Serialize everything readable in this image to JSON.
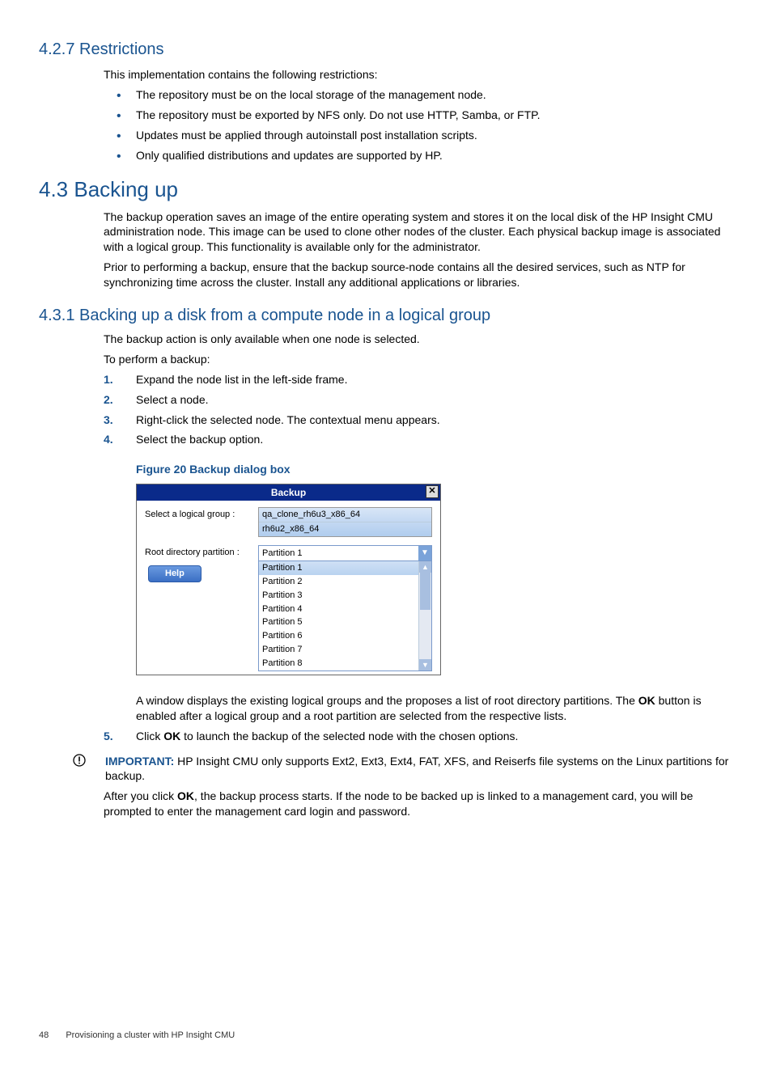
{
  "h427": "4.2.7 Restrictions",
  "p427": "This implementation contains the following restrictions:",
  "bullets427": [
    "The repository must be on the local storage of the management node.",
    "The repository must be exported by NFS only. Do not use HTTP, Samba, or FTP.",
    "Updates must be applied through autoinstall post installation scripts.",
    "Only qualified distributions and updates are supported by HP."
  ],
  "h43": "4.3 Backing up",
  "p43a": "The backup operation saves an image of the entire operating system and stores it on the local disk of the HP Insight CMU administration node. This image can be used to clone other nodes of the cluster. Each physical backup image is associated with a logical group. This functionality is available only for the administrator.",
  "p43b": "Prior to performing a backup, ensure that the backup source-node contains all the desired services, such as NTP for synchronizing time across the cluster. Install any additional applications or libraries.",
  "h431": "4.3.1 Backing up a disk from a compute node in a logical group",
  "p431a": "The backup action is only available when one node is selected.",
  "p431b": "To perform a backup:",
  "steps": {
    "s1": "Expand the node list in the left-side frame.",
    "s2": "Select a node.",
    "s3": "Right-click the selected node. The contextual menu appears.",
    "s4": "Select the backup option.",
    "s5_pre": "Click ",
    "s5_bold": "OK",
    "s5_post": " to launch the backup of the selected node with the chosen options."
  },
  "figcap": "Figure 20 Backup dialog box",
  "dialog": {
    "title": "Backup",
    "close": "✕",
    "label_group": "Select a logical group :",
    "groups": [
      "qa_clone_rh6u3_x86_64",
      "rh6u2_x86_64"
    ],
    "label_root": "Root directory partition :",
    "combo_value": "Partition 1",
    "options": [
      "Partition 1",
      "Partition 2",
      "Partition 3",
      "Partition 4",
      "Partition 5",
      "Partition 6",
      "Partition 7",
      "Partition 8"
    ],
    "help": "Help"
  },
  "after_fig_pre": "A window displays the existing logical groups and the proposes a list of root directory partitions. The ",
  "after_fig_bold": "OK",
  "after_fig_post": " button is enabled after a logical group and a root partition are selected from the respective lists.",
  "important": {
    "label": "IMPORTANT:",
    "text": "   HP Insight CMU only supports Ext2, Ext3, Ext4, FAT, XFS, and Reiserfs file systems on the Linux partitions for backup."
  },
  "after_imp_pre": "After you click ",
  "after_imp_bold": "OK",
  "after_imp_post": ", the backup process starts. If the node to be backed up is linked to a management card, you will be prompted to enter the management card login and password.",
  "footer": {
    "page": "48",
    "title": "Provisioning a cluster with HP Insight CMU"
  }
}
